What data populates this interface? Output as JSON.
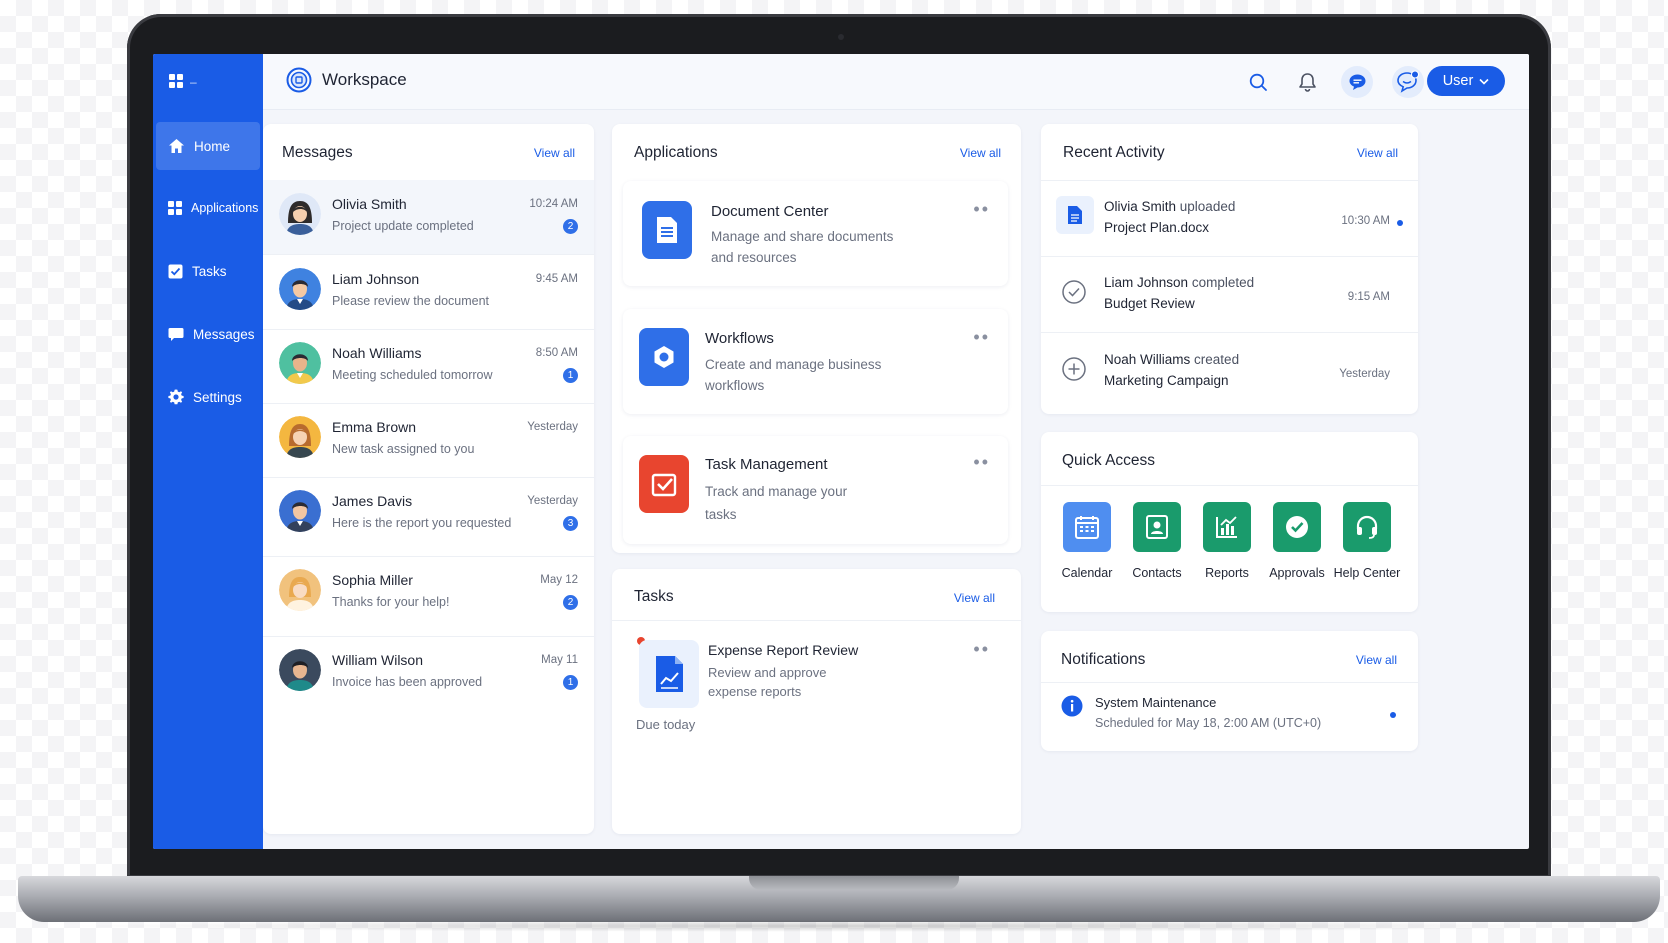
{
  "sidebar": {
    "items": [
      {
        "label": "Home",
        "icon": "home-icon"
      },
      {
        "label": "Applications",
        "icon": "grid-icon"
      },
      {
        "label": "Tasks",
        "icon": "checkbox-icon"
      },
      {
        "label": "Messages",
        "icon": "chat-icon"
      },
      {
        "label": "Settings",
        "icon": "gear-icon"
      }
    ],
    "collapse_label": "–"
  },
  "header": {
    "title": "Workspace",
    "user_label": "User"
  },
  "messages": {
    "title": "Messages",
    "view_all": "View all",
    "items": [
      {
        "name": "Olivia Smith",
        "text": "Project update completed",
        "time": "10:24 AM",
        "badge": "2"
      },
      {
        "name": "Liam Johnson",
        "text": "Please review the document",
        "time": "9:45 AM",
        "badge": ""
      },
      {
        "name": "Noah Williams",
        "text": "Meeting scheduled tomorrow",
        "time": "8:50 AM",
        "badge": "1"
      },
      {
        "name": "Emma Brown",
        "text": "New task assigned to you",
        "time": "Yesterday",
        "badge": ""
      },
      {
        "name": "James Davis",
        "text": "Here is the report you requested",
        "time": "Yesterday",
        "badge": "3"
      },
      {
        "name": "Sophia Miller",
        "text": "Thanks for your help!",
        "time": "May 12",
        "badge": "2"
      },
      {
        "name": "William Wilson",
        "text": "Invoice has been approved",
        "time": "May 11",
        "badge": "1"
      }
    ]
  },
  "applications": {
    "title": "Applications",
    "view_all": "View all",
    "items": [
      {
        "title": "Document Center",
        "desc": "Manage and share documents and resources",
        "icon": "document-icon"
      },
      {
        "title": "Workflows",
        "desc": "Create and manage business workflows",
        "icon": "workflow-icon"
      },
      {
        "title": "Task Management",
        "desc": "Track and manage your tasks",
        "icon": "task-check-icon"
      }
    ]
  },
  "tasks": {
    "title": "Tasks",
    "view_all": "View all",
    "item": {
      "title": "Expense Report Review",
      "desc": "Review and approve expense reports",
      "due": "Due today"
    }
  },
  "activity": {
    "title": "Recent Activity",
    "view_all": "View all",
    "items": [
      {
        "actor": "Olivia Smith",
        "action": "uploaded",
        "object": "Project Plan.docx",
        "time": "10:30 AM"
      },
      {
        "actor": "Liam Johnson",
        "action": "completed",
        "object": "Budget Review",
        "time": "9:15 AM"
      },
      {
        "actor": "Noah Williams",
        "action": "created",
        "object": "Marketing Campaign",
        "time": "Yesterday"
      }
    ]
  },
  "quick_access": {
    "title": "Quick Access",
    "items": [
      {
        "label": "Calendar",
        "color": "#4f8ef0"
      },
      {
        "label": "Contacts",
        "color": "#1a9b6c"
      },
      {
        "label": "Reports",
        "color": "#1a9b6c"
      },
      {
        "label": "Approvals",
        "color": "#1a9b6c"
      },
      {
        "label": "Help Center",
        "color": "#1a9b6c"
      }
    ]
  },
  "notifications": {
    "title": "Notifications",
    "view_all": "View all",
    "item": {
      "title": "System Maintenance",
      "text": "Scheduled for May 18, 2:00 AM (UTC+0)"
    }
  },
  "colors": {
    "accent": "#1a5ce6",
    "danger": "#e8452f",
    "success": "#1a9b6c"
  }
}
